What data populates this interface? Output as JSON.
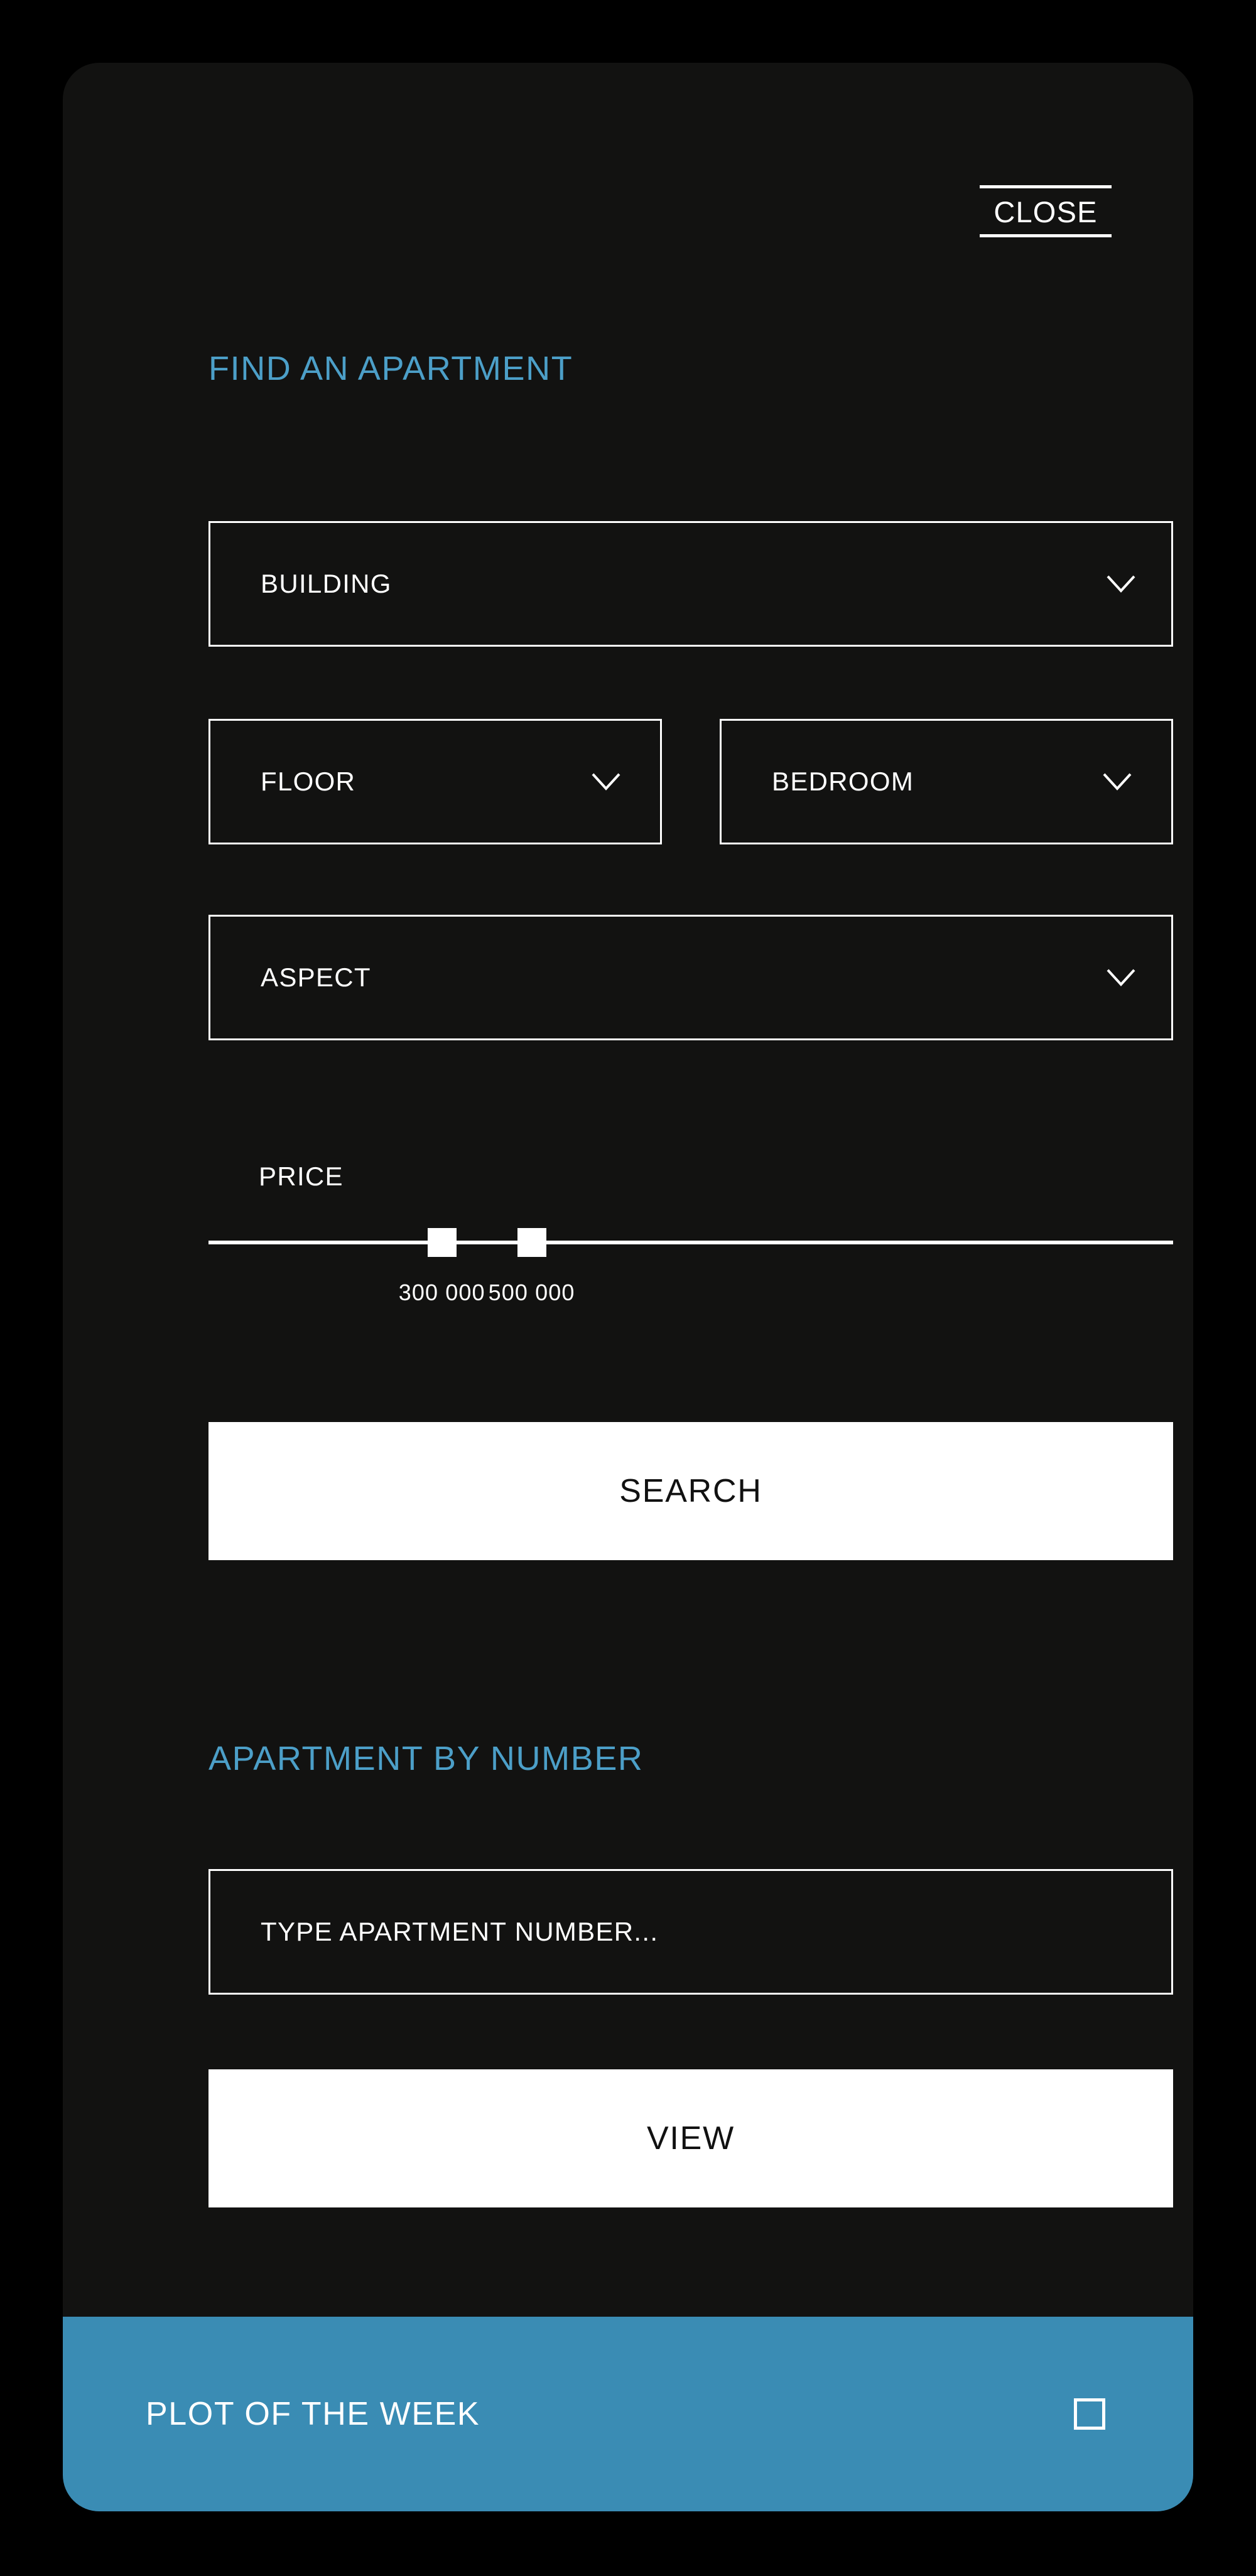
{
  "panel": {
    "background_color": "#121211",
    "accent_blue": "#4c9fc8",
    "bar_blue": "#3a8cb4"
  },
  "close": {
    "label": "CLOSE"
  },
  "find_apartment": {
    "heading": "FIND AN APARTMENT",
    "selects": [
      {
        "label": "BUILDING",
        "icon": "chevron-down-icon"
      },
      {
        "label": "FLOOR",
        "icon": "chevron-down-icon"
      },
      {
        "label": "BEDROOM",
        "icon": "chevron-down-icon"
      },
      {
        "label": "ASPECT",
        "icon": "chevron-down-icon"
      }
    ],
    "price": {
      "label": "PRICE",
      "min_value": "300 000",
      "max_value": "500 000"
    },
    "search_button": "SEARCH"
  },
  "apartment_by_number": {
    "heading": "APARTMENT BY NUMBER",
    "input_placeholder": "TYPE APARTMENT NUMBER...",
    "view_button": "VIEW"
  },
  "plot_of_the_week": {
    "label": "PLOT OF THE WEEK",
    "checkbox_icon": "empty-square-icon"
  }
}
